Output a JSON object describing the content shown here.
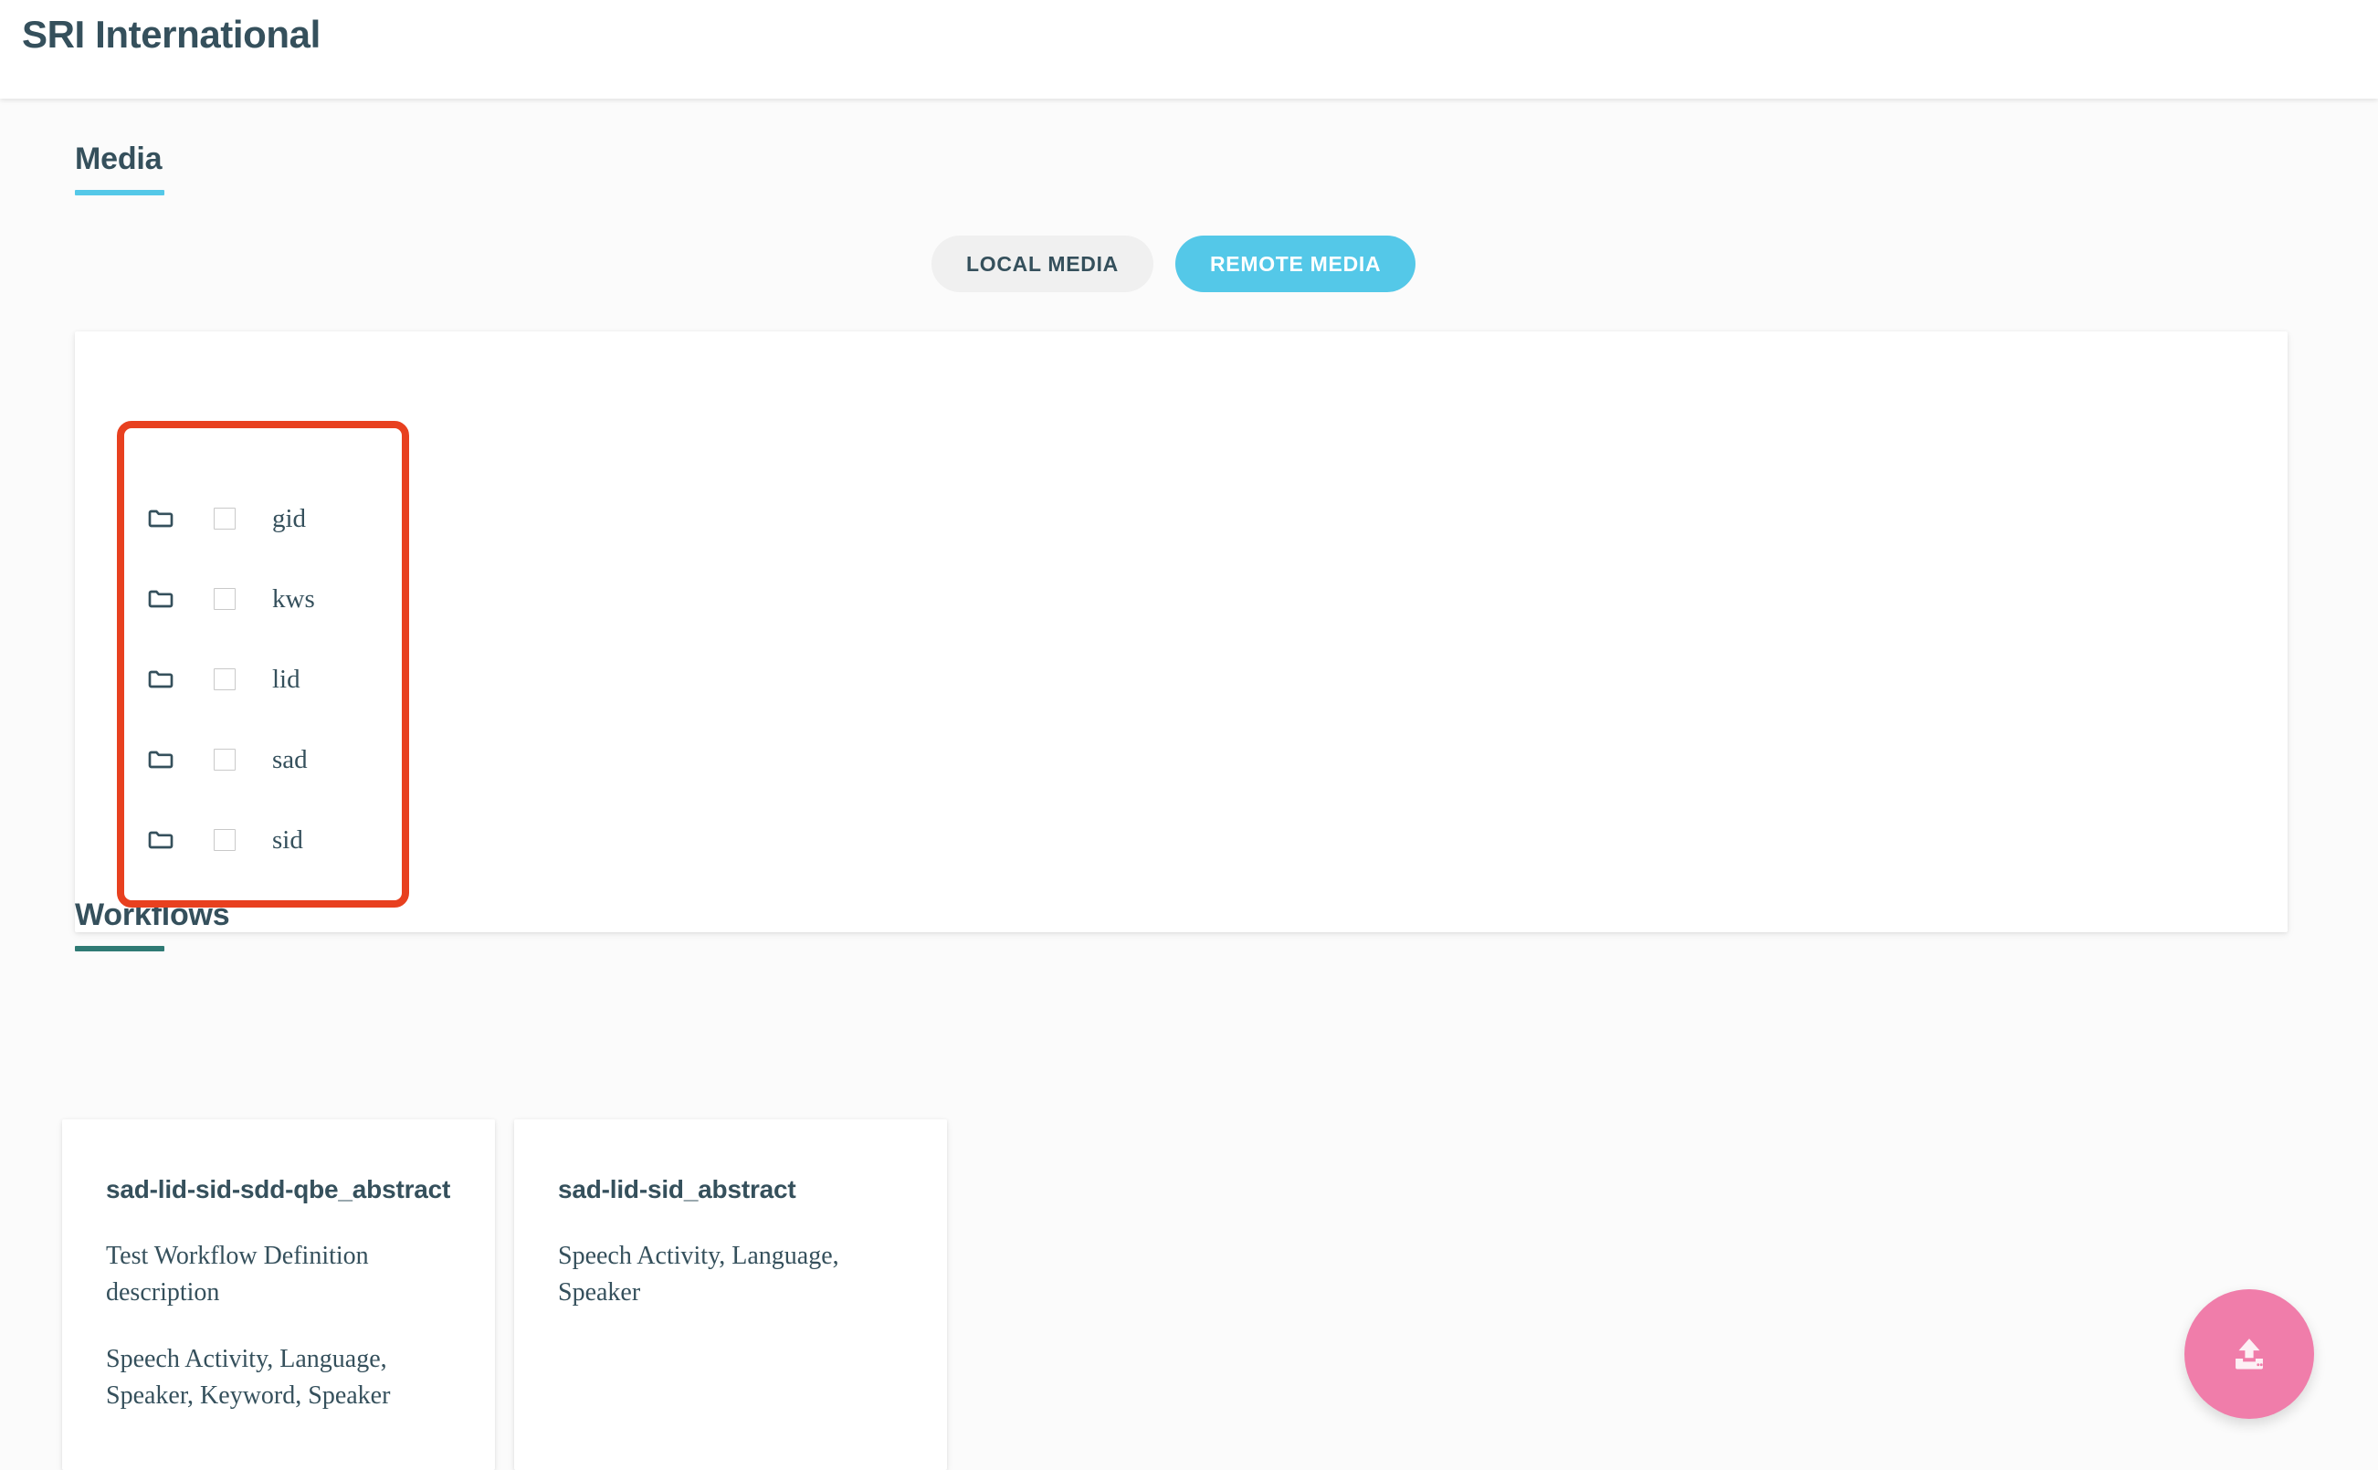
{
  "appbar": {
    "title": "SRI International"
  },
  "media": {
    "heading": "Media",
    "accent_color": "#54c8e8",
    "toggle": {
      "local_label": "LOCAL MEDIA",
      "remote_label": "REMOTE MEDIA",
      "selected": "REMOTE MEDIA"
    },
    "highlight_color": "#e8401f",
    "folders": [
      {
        "name": "gid",
        "checked": false
      },
      {
        "name": "kws",
        "checked": false
      },
      {
        "name": "lid",
        "checked": false
      },
      {
        "name": "sad",
        "checked": false
      },
      {
        "name": "sid",
        "checked": false
      }
    ]
  },
  "workflows": {
    "heading": "Workflows",
    "accent_color": "#2f7a74",
    "cards": [
      {
        "title": "sad-lid-sid-sdd-qbe_abstract",
        "description": "Test Workflow Definition description",
        "tags": "Speech Activity, Language, Speaker, Keyword, Speaker"
      },
      {
        "title": "sad-lid-sid_abstract",
        "description": "",
        "tags": "Speech Activity, Language, Speaker"
      }
    ]
  },
  "fab": {
    "icon": "upload-icon",
    "color": "#f07daa"
  }
}
